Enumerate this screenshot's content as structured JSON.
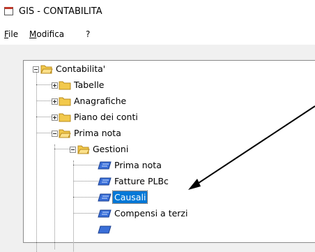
{
  "window": {
    "title": "GIS - CONTABILITA"
  },
  "menu": [
    {
      "label": "File",
      "underline": "F",
      "rest": "ile"
    },
    {
      "label": "Modifica",
      "underline": "M",
      "rest": "odifica"
    },
    {
      "label": "?"
    }
  ],
  "tree": {
    "root": "Contabilita'",
    "items": [
      "Tabelle",
      "Anagrafiche",
      "Piano dei conti",
      "Prima nota"
    ],
    "sub": "Gestioni",
    "leaves": [
      "Prima nota",
      "Fatture PLBc",
      "Causali",
      "Compensi a terzi"
    ],
    "selected": "Causali"
  },
  "colors": {
    "selection": "#0078d7",
    "folder": "#f2c94c",
    "doc_icon": "#3a6fd8",
    "arrow": "#000000"
  }
}
